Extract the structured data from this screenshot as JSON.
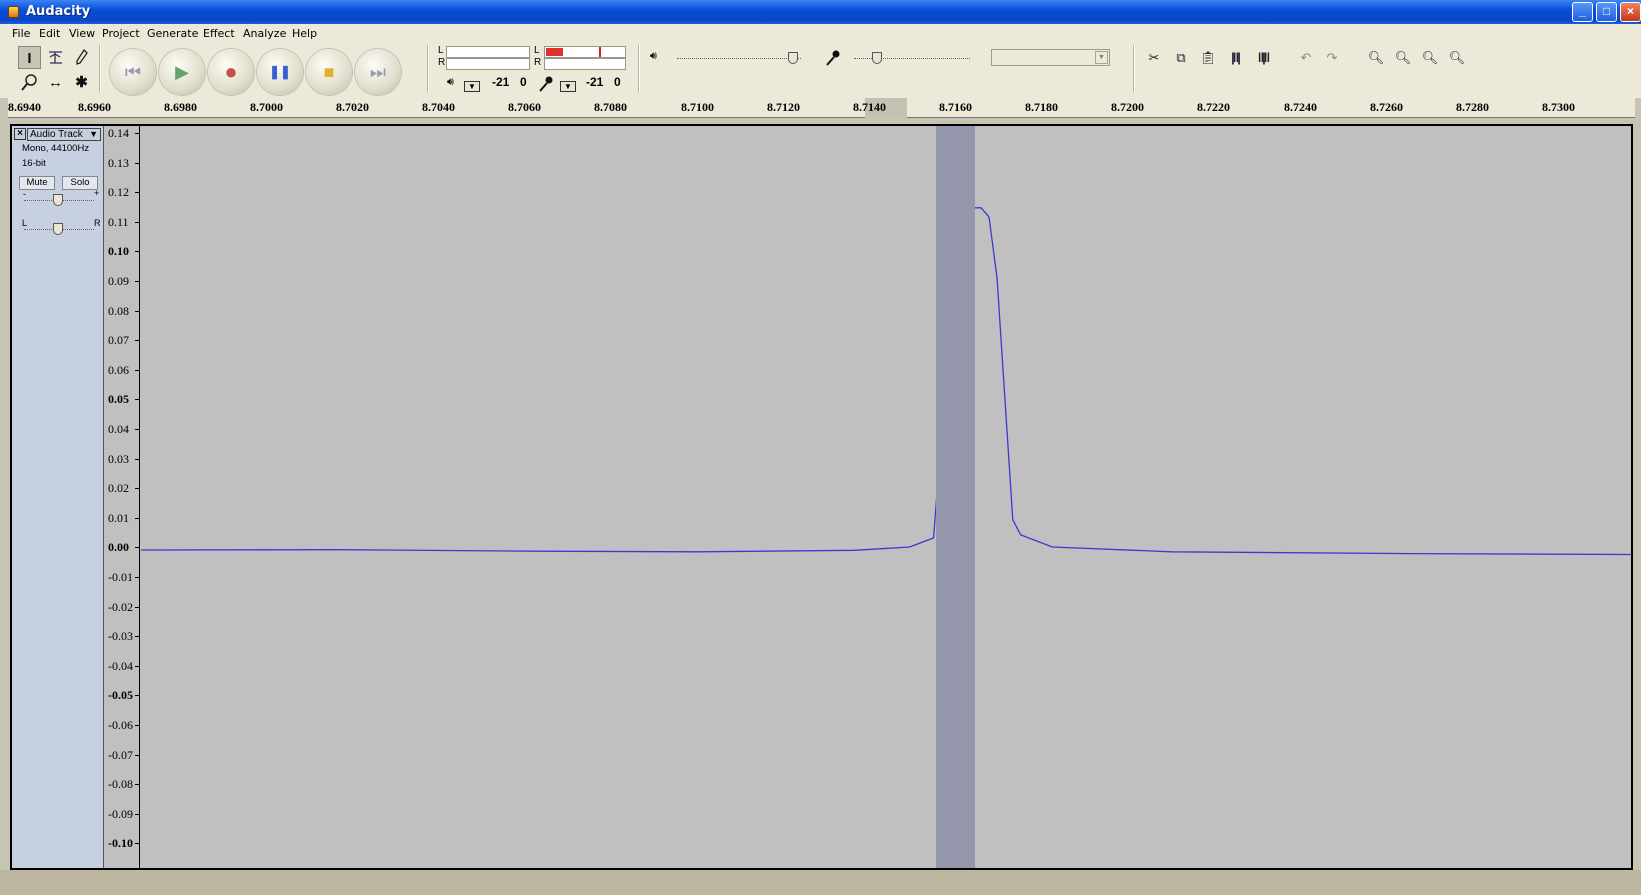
{
  "window": {
    "title": "Audacity"
  },
  "menu": [
    "File",
    "Edit",
    "View",
    "Project",
    "Generate",
    "Effect",
    "Analyze",
    "Help"
  ],
  "tools": {
    "selection": "I",
    "envelope": "envelope-icon",
    "draw": "pencil-icon",
    "zoom": "zoom-icon",
    "timeshift": "↔",
    "multi": "✱"
  },
  "transport": {
    "rewind": "⏮",
    "play": "▶",
    "record": "●",
    "pause": "❚❚",
    "stop": "■",
    "forward": "⏭"
  },
  "meters": {
    "playback": {
      "left_label": "L",
      "right_label": "R",
      "scale_min": "-21",
      "scale_max": "0"
    },
    "record": {
      "left_label": "L",
      "right_label": "R",
      "scale_min": "-21",
      "scale_max": "0"
    }
  },
  "ruler": {
    "ticks": [
      "8.6940",
      "8.6960",
      "8.6980",
      "8.7000",
      "8.7020",
      "8.7040",
      "8.7060",
      "8.7080",
      "8.7100",
      "8.7120",
      "8.7140",
      "8.7160",
      "8.7180",
      "8.7200",
      "8.7220",
      "8.7240",
      "8.7260",
      "8.7280",
      "8.7300"
    ]
  },
  "track": {
    "close": "×",
    "name": "Audio Track",
    "format": "Mono, 44100Hz",
    "bitdepth": "16-bit",
    "mute": "Mute",
    "solo": "Solo",
    "gain_minus": "-",
    "gain_plus": "+",
    "pan_left": "L",
    "pan_right": "R"
  },
  "amplitude_ticks": [
    {
      "label": "0.14",
      "bold": false
    },
    {
      "label": "0.13",
      "bold": false
    },
    {
      "label": "0.12",
      "bold": false
    },
    {
      "label": "0.11",
      "bold": false
    },
    {
      "label": "0.10",
      "bold": true
    },
    {
      "label": "0.09",
      "bold": false
    },
    {
      "label": "0.08",
      "bold": false
    },
    {
      "label": "0.07",
      "bold": false
    },
    {
      "label": "0.06",
      "bold": false
    },
    {
      "label": "0.05",
      "bold": true
    },
    {
      "label": "0.04",
      "bold": false
    },
    {
      "label": "0.03",
      "bold": false
    },
    {
      "label": "0.02",
      "bold": false
    },
    {
      "label": "0.01",
      "bold": false
    },
    {
      "label": "0.00",
      "bold": true
    },
    {
      "label": "-0.01",
      "bold": false
    },
    {
      "label": "-0.02",
      "bold": false
    },
    {
      "label": "-0.03",
      "bold": false
    },
    {
      "label": "-0.04",
      "bold": false
    },
    {
      "label": "-0.05",
      "bold": true
    },
    {
      "label": "-0.06",
      "bold": false
    },
    {
      "label": "-0.07",
      "bold": false
    },
    {
      "label": "-0.08",
      "bold": false
    },
    {
      "label": "-0.09",
      "bold": false
    },
    {
      "label": "-0.10",
      "bold": true
    }
  ],
  "waveform": {
    "color": "#3a3ad0",
    "selection_color": "#9496ac",
    "time_range": [
      8.694,
      8.7316
    ],
    "amplitude_range": [
      -0.105,
      0.14
    ],
    "selection": [
      8.71405,
      8.71505
    ],
    "points": [
      [
        8.694,
        0.0
      ],
      [
        8.699,
        0.0001
      ],
      [
        8.704,
        -0.0004
      ],
      [
        8.708,
        -0.0006
      ],
      [
        8.712,
        -0.0001
      ],
      [
        8.7134,
        0.001
      ],
      [
        8.7137,
        0.0025
      ],
      [
        8.714,
        0.004
      ],
      [
        8.71415,
        0.03
      ],
      [
        8.7143,
        0.08
      ],
      [
        8.7145,
        0.106
      ],
      [
        8.7148,
        0.113
      ],
      [
        8.7152,
        0.113
      ],
      [
        8.7154,
        0.11
      ],
      [
        8.7156,
        0.09
      ],
      [
        8.7158,
        0.05
      ],
      [
        8.716,
        0.01
      ],
      [
        8.7162,
        0.005
      ],
      [
        8.717,
        0.001
      ],
      [
        8.72,
        -0.0006
      ],
      [
        8.726,
        -0.0012
      ],
      [
        8.7316,
        -0.0015
      ]
    ]
  }
}
